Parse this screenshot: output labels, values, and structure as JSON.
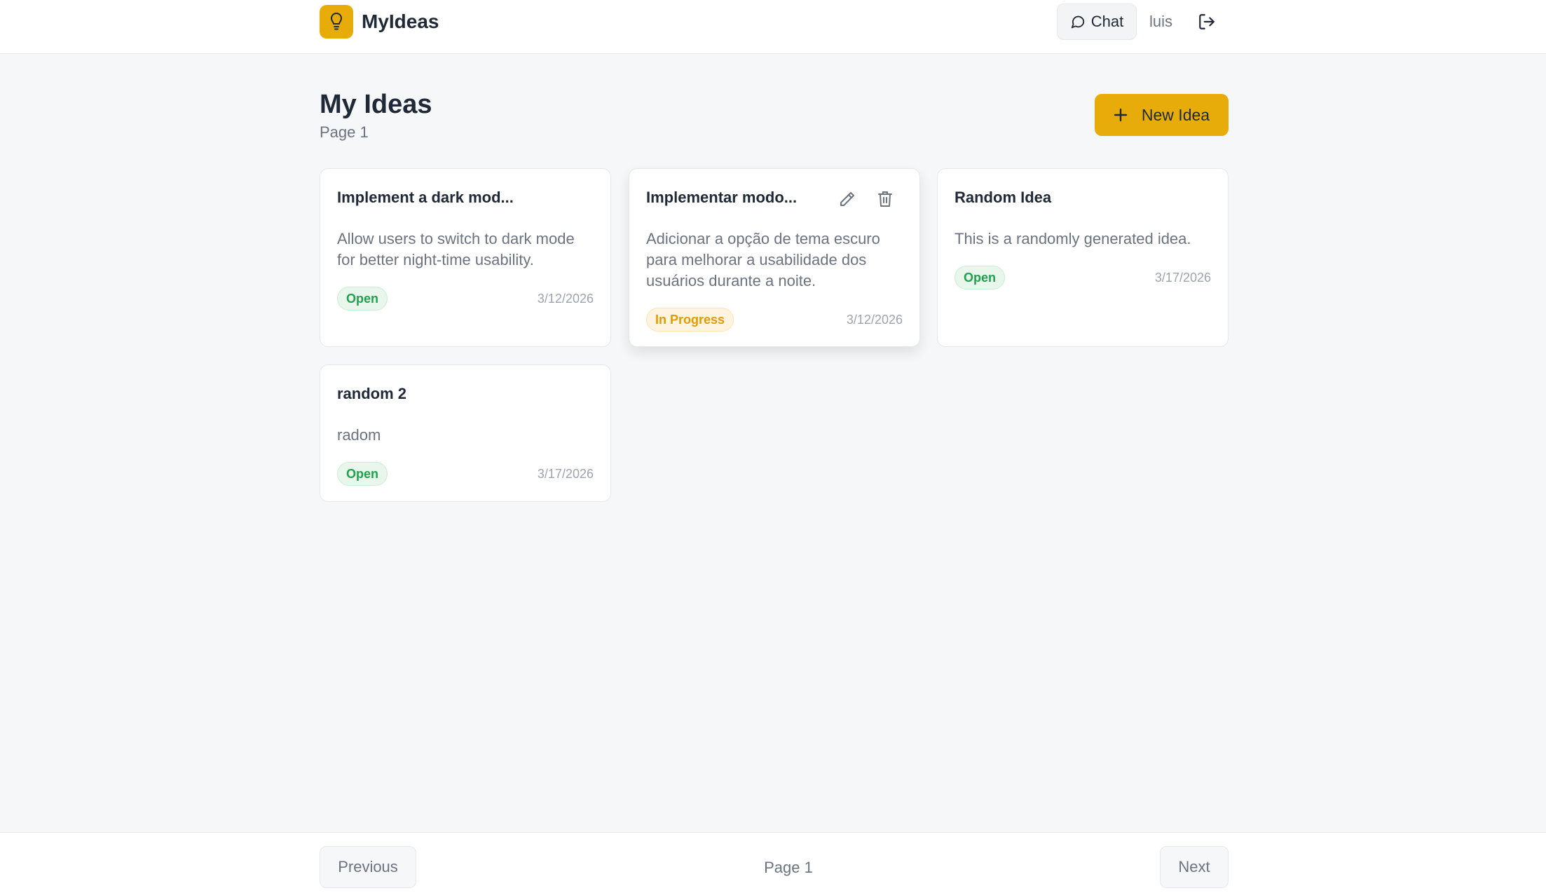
{
  "header": {
    "brand": "MyIdeas",
    "chat_label": "Chat",
    "user": "luis",
    "icons": {
      "logo": "lightbulb-icon",
      "chat": "message-circle-icon",
      "logout": "log-out-icon"
    }
  },
  "main": {
    "title": "My Ideas",
    "subtitle": "Page 1",
    "new_button_label": "New Idea"
  },
  "ideas": [
    {
      "title": "Implement a dark mod...",
      "description": "Allow users to switch to dark mode for better night-time usability.",
      "status": "Open",
      "date": "3/12/2026"
    },
    {
      "title": "Implementar modo...",
      "description": "Adicionar a opção de tema escuro para melhorar a usabilidade dos usuários durante a noite.",
      "status": "In Progress",
      "date": "3/12/2026"
    },
    {
      "title": "Random Idea",
      "description": "This is a randomly generated idea.",
      "status": "Open",
      "date": "3/17/2026"
    },
    {
      "title": "random 2",
      "description": "radom",
      "status": "Open",
      "date": "3/17/2026"
    }
  ],
  "pagination": {
    "previous": "Previous",
    "label": "Page 1",
    "next": "Next"
  },
  "colors": {
    "accent": "#e8ac0a",
    "open": "#22a04d",
    "in_progress": "#e39a06"
  }
}
